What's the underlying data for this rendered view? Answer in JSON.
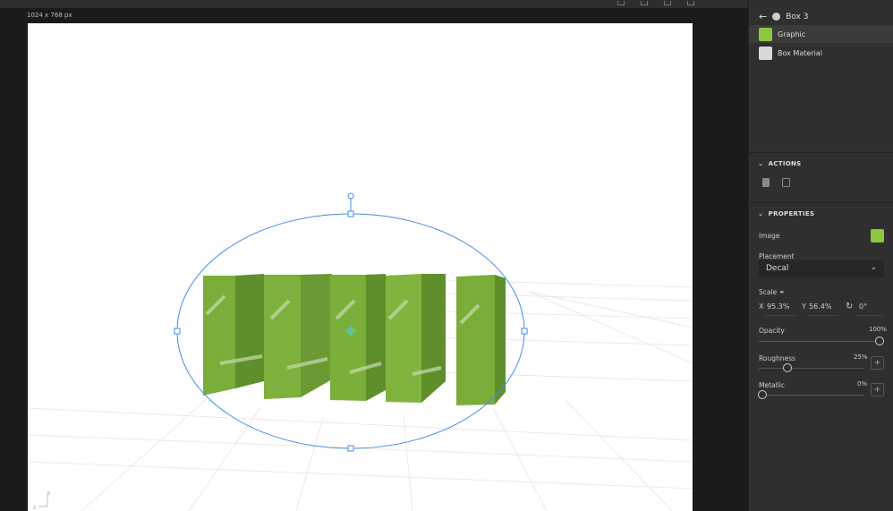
{
  "canvas": {
    "dimensions": "1024 x 768 px",
    "axis_y": "y",
    "axis_z": "z"
  },
  "panel": {
    "title": "Box 3",
    "layers": [
      {
        "label": "Graphic",
        "color": "#8dc63f"
      },
      {
        "label": "Box Material",
        "color": "#d8d8d8"
      }
    ],
    "actions_label": "ACTIONS",
    "properties_label": "PROPERTIES",
    "image_label": "Image",
    "image_color": "#8dc63f",
    "placement_label": "Placement",
    "placement_value": "Decal",
    "scale_label": "Scale",
    "scale_x_label": "X",
    "scale_x": "95.3%",
    "scale_y_label": "Y",
    "scale_y": "56.4%",
    "rotation": "0°",
    "opacity_label": "Opacity",
    "opacity": "100%",
    "opacity_value": 100,
    "roughness_label": "Roughness",
    "roughness": "25%",
    "roughness_value": 25,
    "metallic_label": "Metallic",
    "metallic": "0%",
    "metallic_value": 0
  }
}
